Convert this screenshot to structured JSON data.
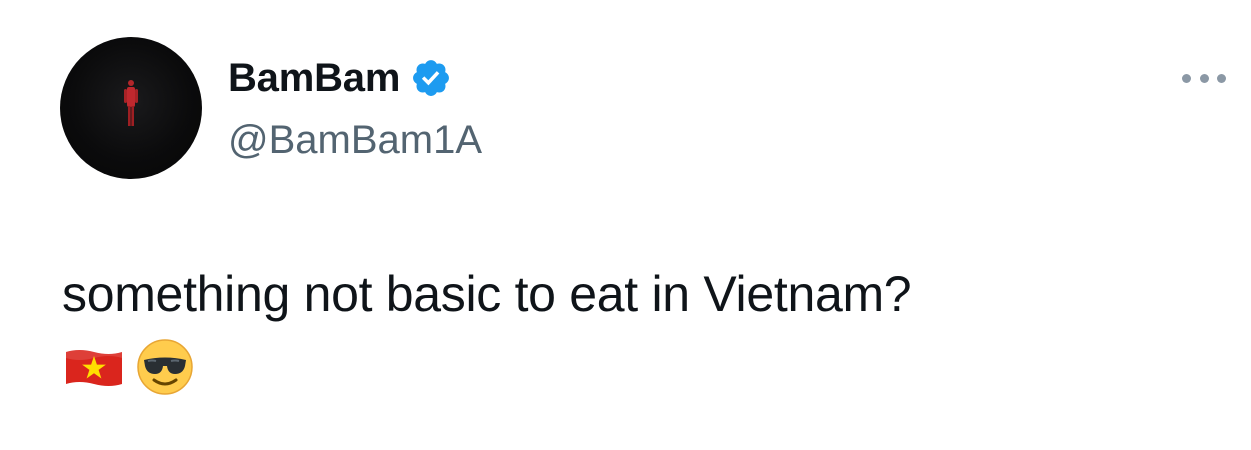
{
  "author": {
    "display_name": "BamBam",
    "handle": "@BamBam1A",
    "verified": true,
    "avatar_icon": "avatar-photo",
    "verified_icon": "verified-badge-icon"
  },
  "tweet": {
    "text": "something not basic to eat in Vietnam?",
    "emojis": [
      "vietnam-flag-icon",
      "smiling-face-with-sunglasses-icon"
    ]
  },
  "actions": {
    "more_icon": "more-horizontal-icon"
  },
  "colors": {
    "text_primary": "#0f1419",
    "text_secondary": "#536471",
    "verified_blue": "#1d9bf0",
    "more_dots": "#8b98a5",
    "flag_red": "#da251d",
    "flag_star": "#ffde00",
    "emoji_yellow": "#ffcc4d"
  }
}
